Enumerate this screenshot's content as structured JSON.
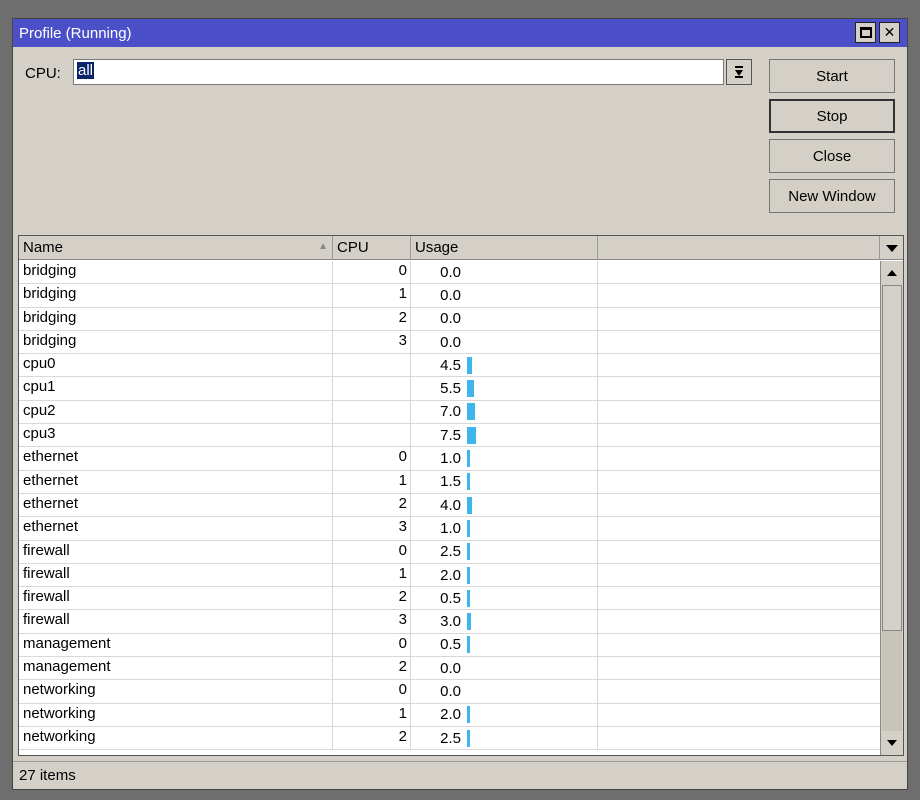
{
  "window": {
    "title": "Profile (Running)"
  },
  "cpu_filter": {
    "label": "CPU:",
    "value": "all"
  },
  "buttons": {
    "start": "Start",
    "stop": "Stop",
    "close": "Close",
    "new_window": "New Window"
  },
  "table": {
    "columns": [
      "Name",
      "CPU",
      "Usage"
    ],
    "rows": [
      {
        "name": "bridging",
        "cpu": "0",
        "usage": "0.0"
      },
      {
        "name": "bridging",
        "cpu": "1",
        "usage": "0.0"
      },
      {
        "name": "bridging",
        "cpu": "2",
        "usage": "0.0"
      },
      {
        "name": "bridging",
        "cpu": "3",
        "usage": "0.0"
      },
      {
        "name": "cpu0",
        "cpu": "",
        "usage": "4.5"
      },
      {
        "name": "cpu1",
        "cpu": "",
        "usage": "5.5"
      },
      {
        "name": "cpu2",
        "cpu": "",
        "usage": "7.0"
      },
      {
        "name": "cpu3",
        "cpu": "",
        "usage": "7.5"
      },
      {
        "name": "ethernet",
        "cpu": "0",
        "usage": "1.0"
      },
      {
        "name": "ethernet",
        "cpu": "1",
        "usage": "1.5"
      },
      {
        "name": "ethernet",
        "cpu": "2",
        "usage": "4.0"
      },
      {
        "name": "ethernet",
        "cpu": "3",
        "usage": "1.0"
      },
      {
        "name": "firewall",
        "cpu": "0",
        "usage": "2.5"
      },
      {
        "name": "firewall",
        "cpu": "1",
        "usage": "2.0"
      },
      {
        "name": "firewall",
        "cpu": "2",
        "usage": "0.5"
      },
      {
        "name": "firewall",
        "cpu": "3",
        "usage": "3.0"
      },
      {
        "name": "management",
        "cpu": "0",
        "usage": "0.5"
      },
      {
        "name": "management",
        "cpu": "2",
        "usage": "0.0"
      },
      {
        "name": "networking",
        "cpu": "0",
        "usage": "0.0"
      },
      {
        "name": "networking",
        "cpu": "1",
        "usage": "2.0"
      },
      {
        "name": "networking",
        "cpu": "2",
        "usage": "2.5"
      }
    ]
  },
  "status": {
    "count": "27 items"
  },
  "colors": {
    "titlebar": "#4c50c8",
    "usage_bar": "#3eb6ec"
  }
}
